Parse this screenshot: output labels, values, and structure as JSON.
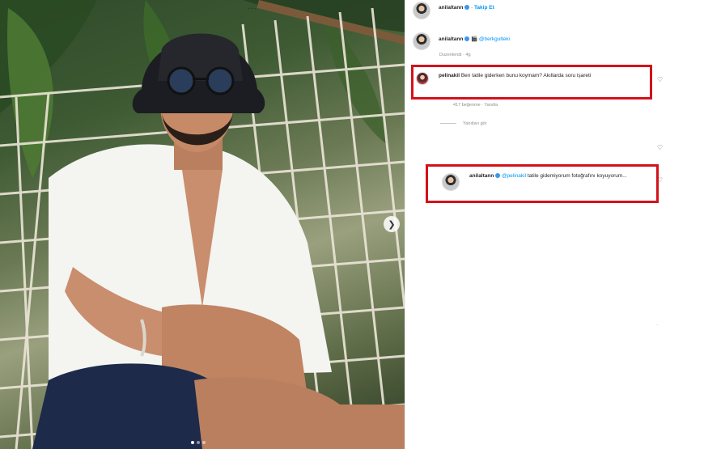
{
  "post": {
    "username": "anilaltann",
    "follow_label": "Takip Et",
    "more_label": "..."
  },
  "caption": {
    "username": "anilaltann",
    "mention": "@berkgulteki",
    "meta": "Duzenlendi · 4g"
  },
  "comments": [
    {
      "username": "pelinakil",
      "text": "Ben tatile giderken bunu koymam? Akıllarda soru işareti",
      "meta": "417 beğenme · Yanıtla",
      "view_replies": "Yanıtları gör"
    },
    {
      "username": "anilaltann",
      "mention": "@pelinakil",
      "text": "tatile gidemiyorum fotoğrafını koyuyorum...",
      "meta": ""
    }
  ],
  "icons": {
    "heart": "heart-outline-icon",
    "verified": "verified-badge-icon",
    "next": "chevron-right-icon",
    "more": "more-options-icon"
  },
  "colors": {
    "highlight_border": "#d3121b",
    "link": "#0095f6",
    "verified": "#3897f0"
  }
}
